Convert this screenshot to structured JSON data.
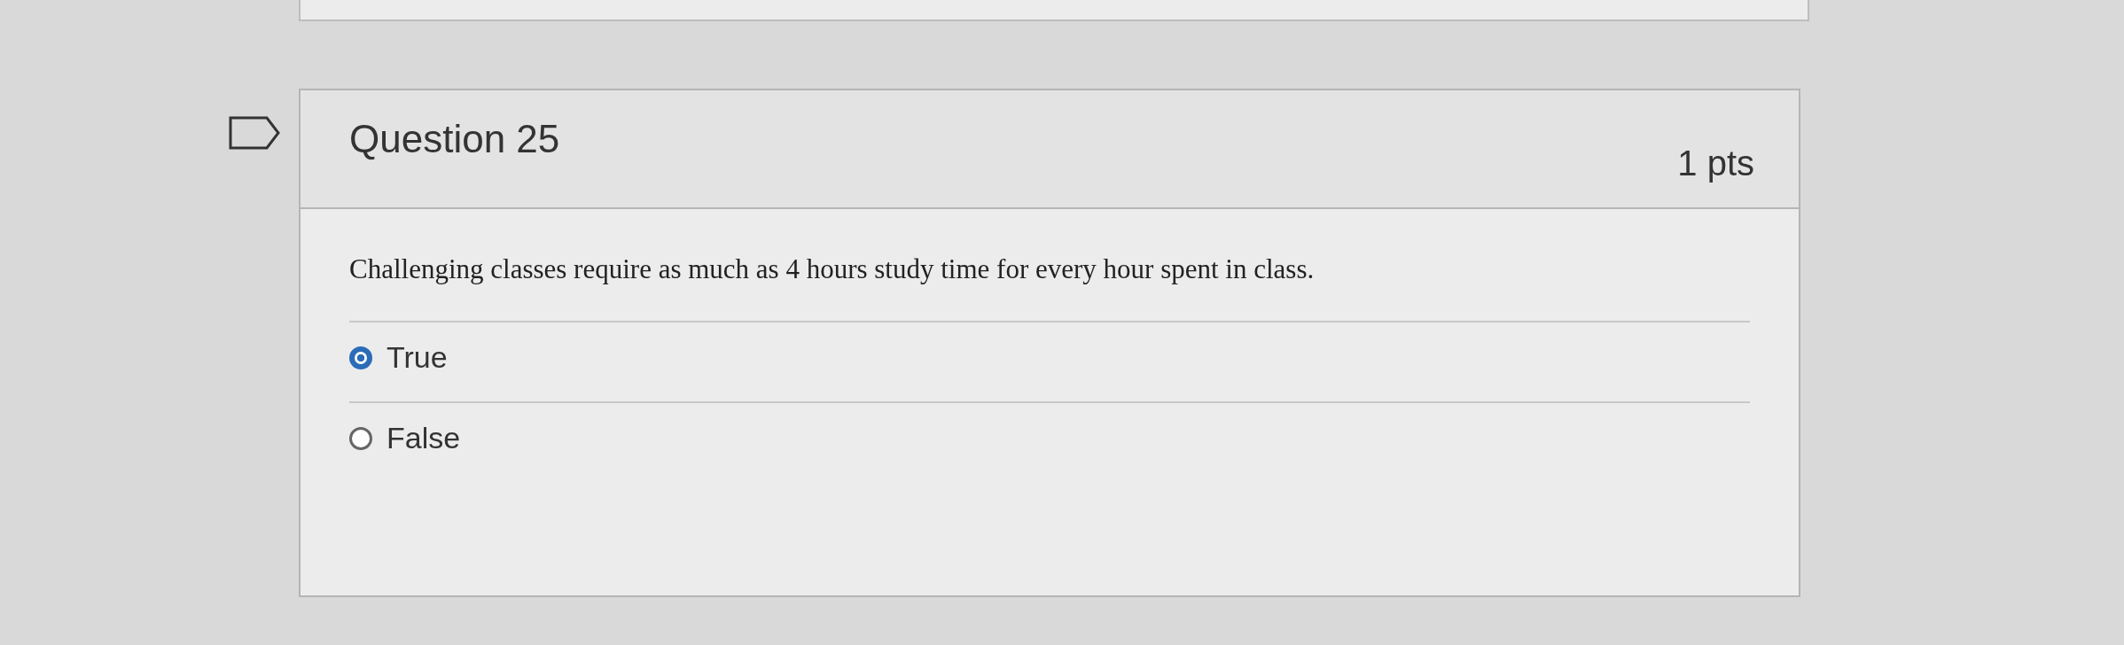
{
  "question": {
    "title": "Question 25",
    "points": "1 pts",
    "flagged": false,
    "text": "Challenging classes require as much as 4 hours study time for every hour spent in class.",
    "answers": [
      {
        "label": "True",
        "selected": true
      },
      {
        "label": "False",
        "selected": false
      }
    ]
  }
}
